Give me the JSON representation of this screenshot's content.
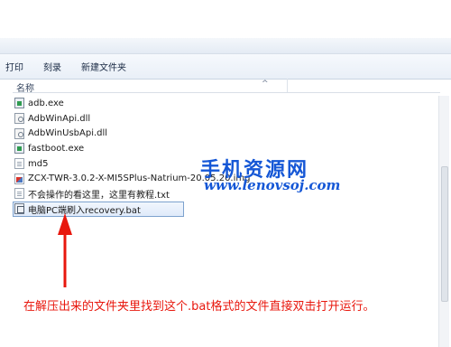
{
  "toolbar": {
    "print_label": "打印",
    "burn_label": "刻录",
    "new_folder_label": "新建文件夹"
  },
  "list_header": {
    "name_label": "名称"
  },
  "files": [
    {
      "name": "adb.exe",
      "icon": "exe-icon"
    },
    {
      "name": "AdbWinApi.dll",
      "icon": "dll-icon"
    },
    {
      "name": "AdbWinUsbApi.dll",
      "icon": "dll-icon"
    },
    {
      "name": "fastboot.exe",
      "icon": "exe-icon"
    },
    {
      "name": "md5",
      "icon": "document-icon"
    },
    {
      "name": "ZCX-TWR-3.0.2-X-MI5SPlus-Natrium-20.05.20.img",
      "icon": "image-icon"
    },
    {
      "name": "不会操作的看这里，这里有教程.txt",
      "icon": "text-file-icon"
    },
    {
      "name": "电脑PC端刷入recovery.bat",
      "icon": "batch-file-icon",
      "selected": true
    }
  ],
  "watermark": {
    "title": "手机资源网",
    "url": "www.lenovsoj.com"
  },
  "annotation": {
    "caption": "在解压出来的文件夹里找到这个.bat格式的文件直接双击打开运行。",
    "arrow_color": "#e8170d"
  },
  "colors": {
    "watermark": "#1557d6",
    "annotation_red": "#e8170d",
    "selection_border": "#7da2ce"
  }
}
